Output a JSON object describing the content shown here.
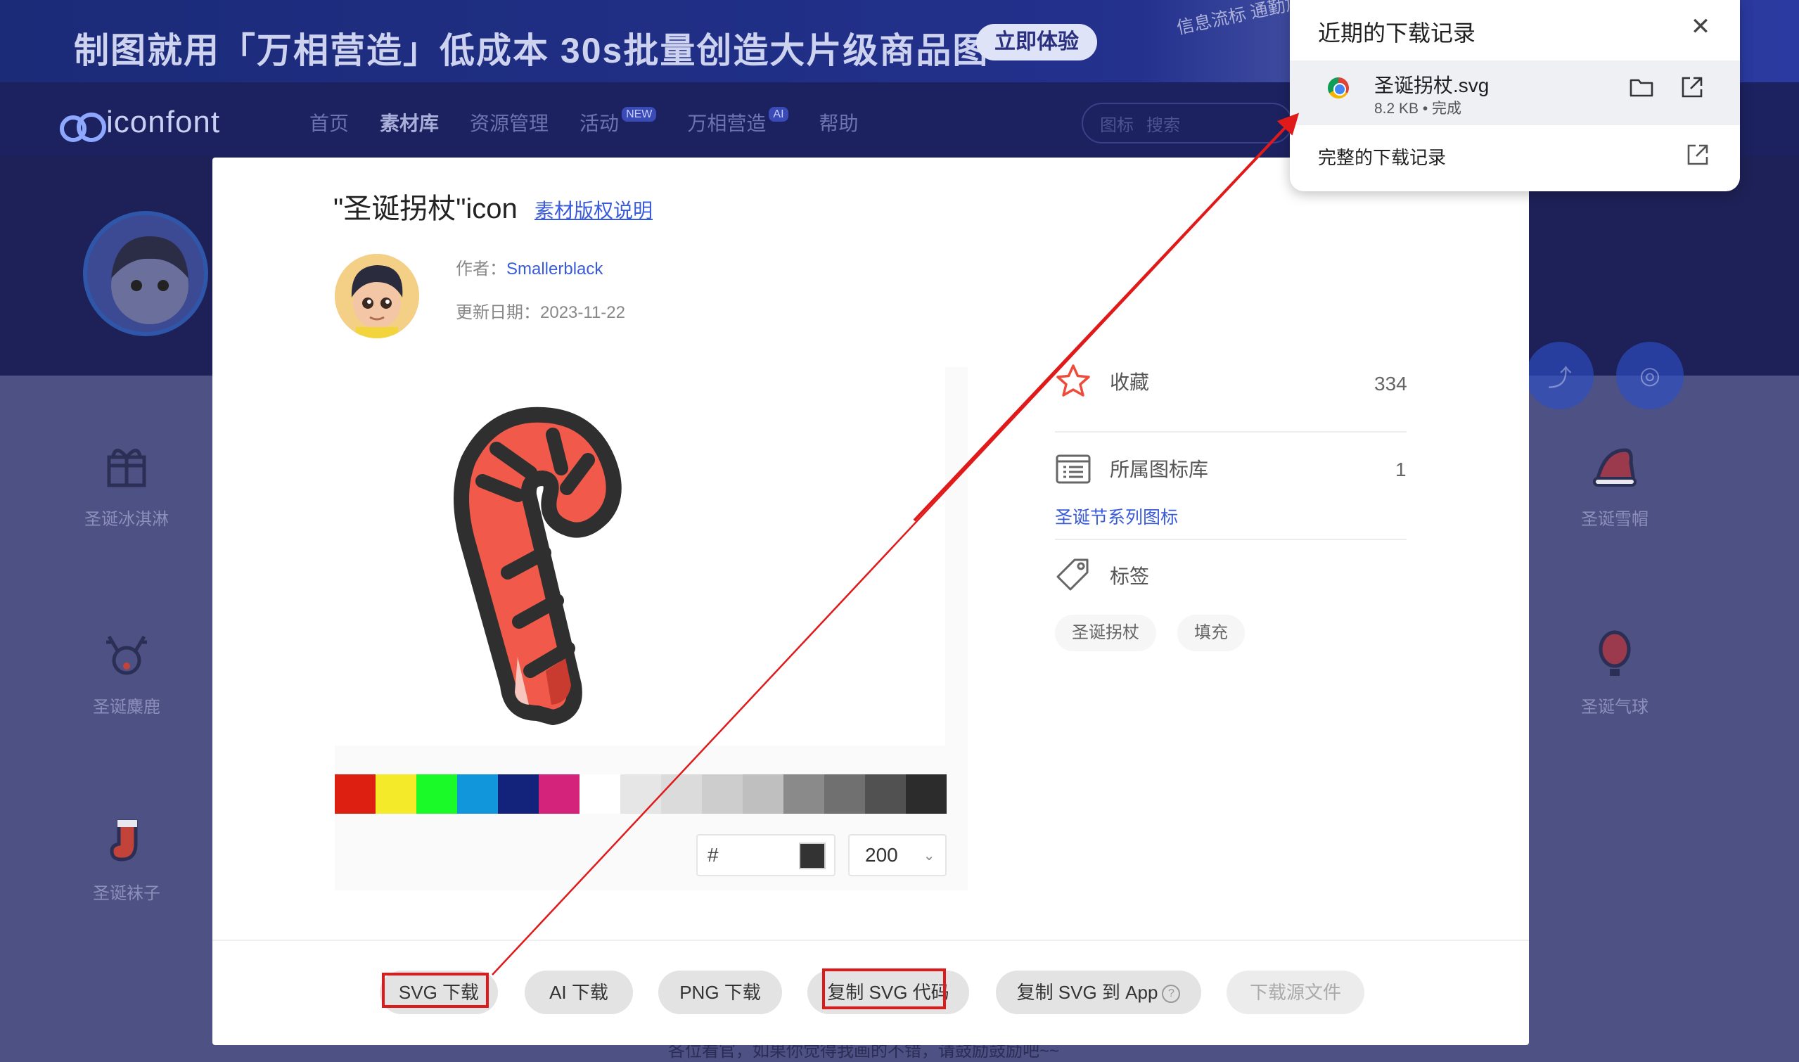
{
  "banner": {
    "headline": "制图就用「万相营造」低成本 30s批量创造大片级商品图",
    "cta": "立即体验",
    "side_text": "信息流标 通勤加云彩 奶糖芬芳"
  },
  "nav": {
    "logo": "iconfont",
    "items": [
      {
        "label": "首页"
      },
      {
        "label": "素材库"
      },
      {
        "label": "资源管理"
      },
      {
        "label": "活动",
        "badge": "NEW"
      },
      {
        "label": "万相营造",
        "badge": "AI"
      },
      {
        "label": "帮助"
      }
    ],
    "search_type": "图标",
    "search_placeholder": "搜索"
  },
  "background_icons": {
    "left": [
      "圣诞冰淇淋",
      "圣诞麋鹿",
      "圣诞袜子"
    ],
    "right": [
      "圣诞雪帽",
      "圣诞气球"
    ],
    "footer_text": "各位看官，如果你觉得我画的不错，请鼓励鼓励吧~~"
  },
  "modal": {
    "title": "\"圣诞拐杖\"icon",
    "license_link": "素材版权说明",
    "author_label": "作者：",
    "author_name": "Smallerblack",
    "date_label": "更新日期：",
    "date": "2023-11-22",
    "palette": [
      "#dd1f12",
      "#f4ea2a",
      "#1afa29",
      "#1296db",
      "#13227a",
      "#d4237a",
      "#ffffff",
      "#e6e6e6",
      "#dbdbdb",
      "#cdcdcd",
      "#bfbfbf",
      "#8a8a8a",
      "#707070",
      "#515151",
      "#2c2c2c"
    ],
    "color_prefix": "#",
    "current_color": "#333333",
    "size_value": "200",
    "stats": {
      "favorite_label": "收藏",
      "favorite_count": "334",
      "library_label": "所属图标库",
      "library_count": "1",
      "library_link": "圣诞节系列图标",
      "tags_label": "标签",
      "tags": [
        "圣诞拐杖",
        "填充"
      ]
    },
    "buttons": {
      "svg_download": "SVG 下载",
      "ai_download": "AI 下载",
      "png_download": "PNG 下载",
      "copy_svg_code": "复制 SVG 代码",
      "copy_svg_app": "复制 SVG 到 App",
      "download_source": "下载源文件"
    }
  },
  "downloads": {
    "title": "近期的下载记录",
    "file_name": "圣诞拐杖.svg",
    "file_meta": "8.2 KB • 完成",
    "full_history": "完整的下载记录"
  },
  "colors": {
    "accent": "#3a5bd9",
    "annotation_red": "#e01a1a",
    "cane_red": "#f15a4a",
    "cane_outline": "#2f2f2f"
  }
}
